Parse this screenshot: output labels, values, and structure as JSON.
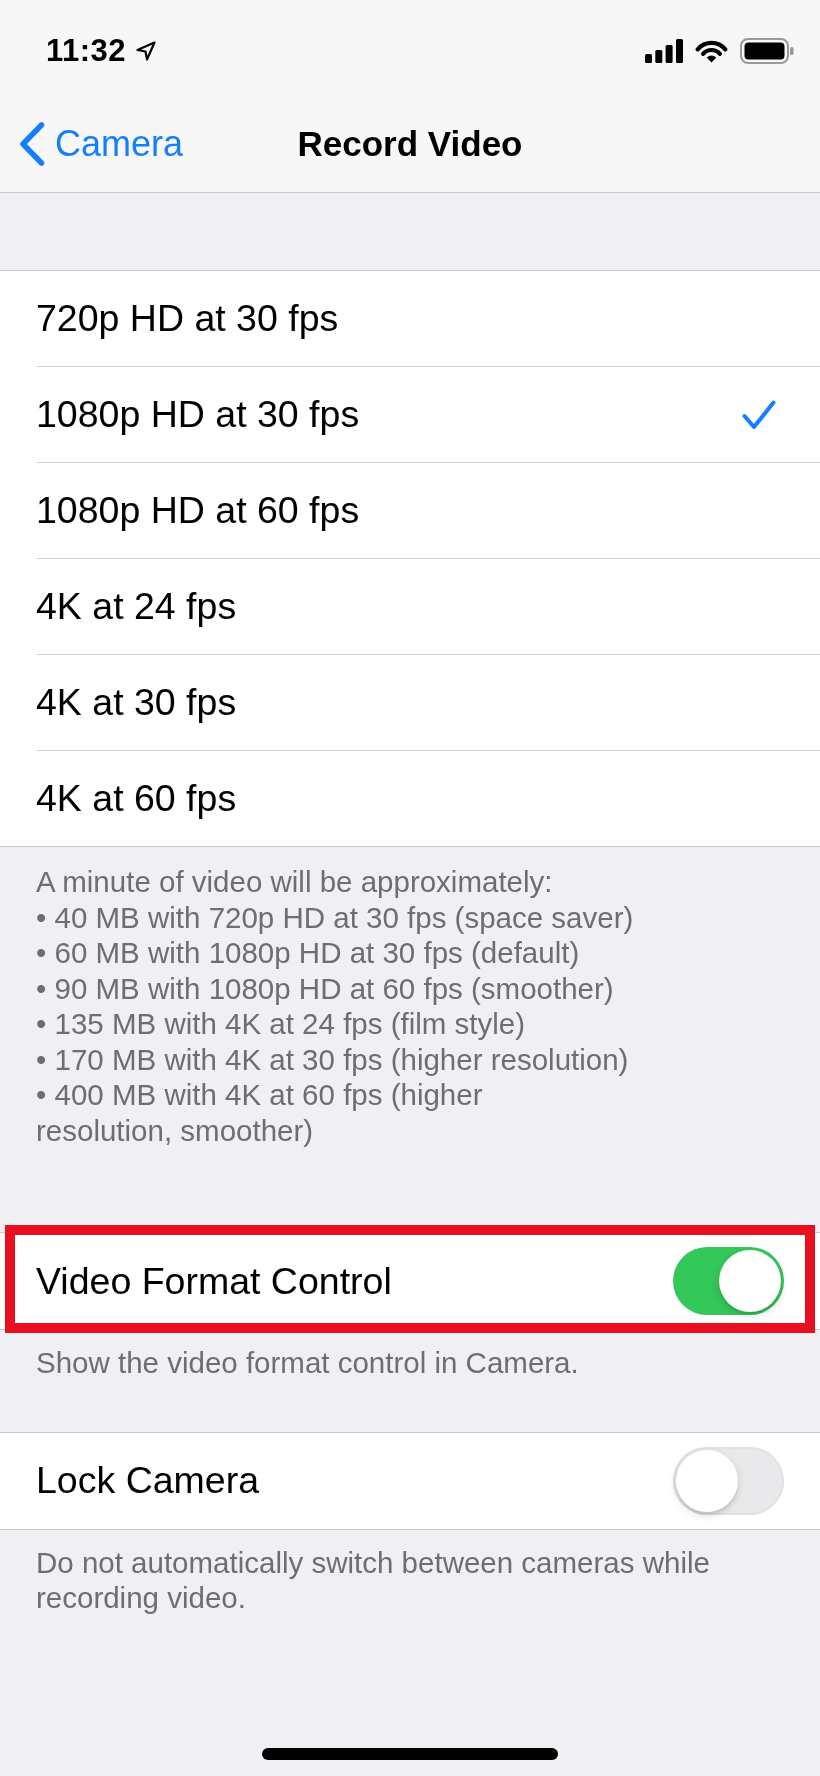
{
  "status_bar": {
    "time": "11:32"
  },
  "navigation": {
    "back": "Camera",
    "title": "Record Video"
  },
  "formats": {
    "options": [
      {
        "label": "720p HD at 30 fps",
        "selected": false
      },
      {
        "label": "1080p HD at 30 fps",
        "selected": true
      },
      {
        "label": "1080p HD at 60 fps",
        "selected": false
      },
      {
        "label": "4K at 24 fps",
        "selected": false
      },
      {
        "label": "4K at 30 fps",
        "selected": false
      },
      {
        "label": "4K at 60 fps",
        "selected": false
      }
    ],
    "footer": "A minute of video will be approximately:\n• 40 MB with 720p HD at 30 fps (space saver)\n• 60 MB with 1080p HD at 30 fps (default)\n• 90 MB with 1080p HD at 60 fps (smoother)\n• 135 MB with 4K at 24 fps (film style)\n• 170 MB with 4K at 30 fps (higher resolution)\n• 400 MB with 4K at 60 fps (higher\nresolution, smoother)"
  },
  "switches": [
    {
      "label": "Video Format Control",
      "on": true,
      "highlighted": true,
      "footer": "Show the video format control in Camera."
    },
    {
      "label": "Lock Camera",
      "on": false,
      "highlighted": false,
      "footer": "Do not automatically switch between cameras while recording video."
    }
  ]
}
